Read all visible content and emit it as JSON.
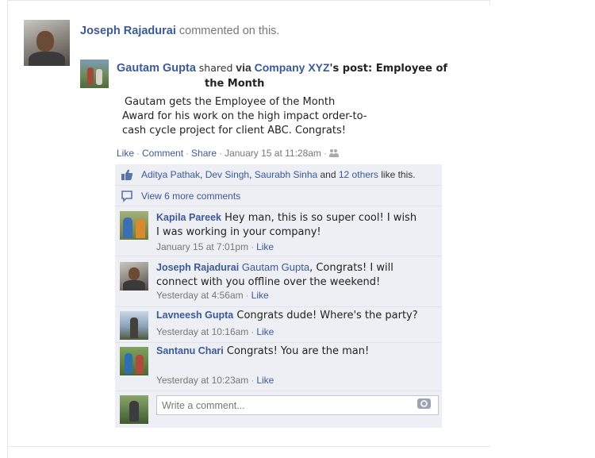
{
  "activity": {
    "actor": "Joseph Rajadurai",
    "action": "commented on this."
  },
  "share": {
    "author": "Gautam Gupta",
    "verb": "shared",
    "via": "via",
    "company": "Company XYZ",
    "post_label_part1": "'s post: Employee of",
    "post_label_part2": "the Month"
  },
  "post": {
    "line1": "Gautam gets the Employee of the Month",
    "line2": "Award for his work on the high impact order-to-",
    "line3": "cash cycle  project for client ABC. Congrats!"
  },
  "actions": {
    "like": "Like",
    "comment": "Comment",
    "share": "Share",
    "timestamp": "January 15 at 11:28am",
    "sep": "·"
  },
  "likes": {
    "person1": "Aditya Pathak",
    "comma1": ", ",
    "person2": "Dev Singh",
    "comma2": ", ",
    "person3": "Saurabh Sinha",
    "and": " and ",
    "others": "12 others",
    "suffix": " like this."
  },
  "view_more": "View 6 more comments",
  "comments": [
    {
      "author": "Kapila Pareek",
      "text_line1": " Hey man, this is so super cool! I wish",
      "text_line2": "I was working in your company!",
      "time": "January 15 at 7:01pm",
      "like": "Like"
    },
    {
      "author": "Joseph Rajadurai",
      "mention": " Gautam Gupta",
      "text_line1": ", Congrats! I will",
      "text_line2": "connect with you offline over the weekend!",
      "time": "Yesterday at 4:56am",
      "like": "Like"
    },
    {
      "author": "Lavneesh Gupta",
      "text_line1": " Congrats dude! Where's the party?",
      "time": "Yesterday at 10:16am",
      "like": "Like"
    },
    {
      "author": "Santanu Chari",
      "text_line1": " Congrats! You are the man!",
      "time": "Yesterday at 10:23am",
      "like": "Like"
    }
  ],
  "composer": {
    "placeholder": "Write a comment..."
  },
  "colors": {
    "link": "#3b5998",
    "panel": "#edeff4",
    "muted": "#777777"
  },
  "icons": [
    "thumbs-up-icon",
    "speech-bubble-icon",
    "people-icon",
    "camera-icon"
  ]
}
